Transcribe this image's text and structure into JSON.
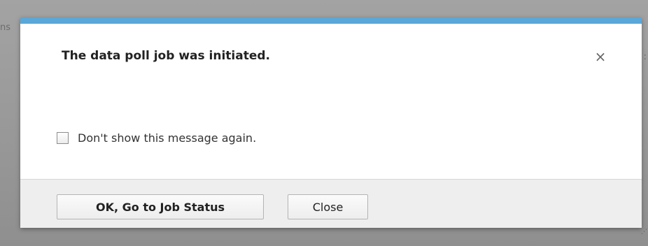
{
  "background": {
    "left_fragment": "ns",
    "right_fragment": ":"
  },
  "dialog": {
    "accent_color": "#5aa7d8",
    "title": "The data poll job was initiated.",
    "close_icon": "close-icon",
    "close_glyph": "×",
    "checkbox": {
      "label": "Don't show this message again.",
      "checked": false
    },
    "buttons": {
      "ok_label": "OK, Go to Job Status",
      "close_label": "Close"
    }
  }
}
